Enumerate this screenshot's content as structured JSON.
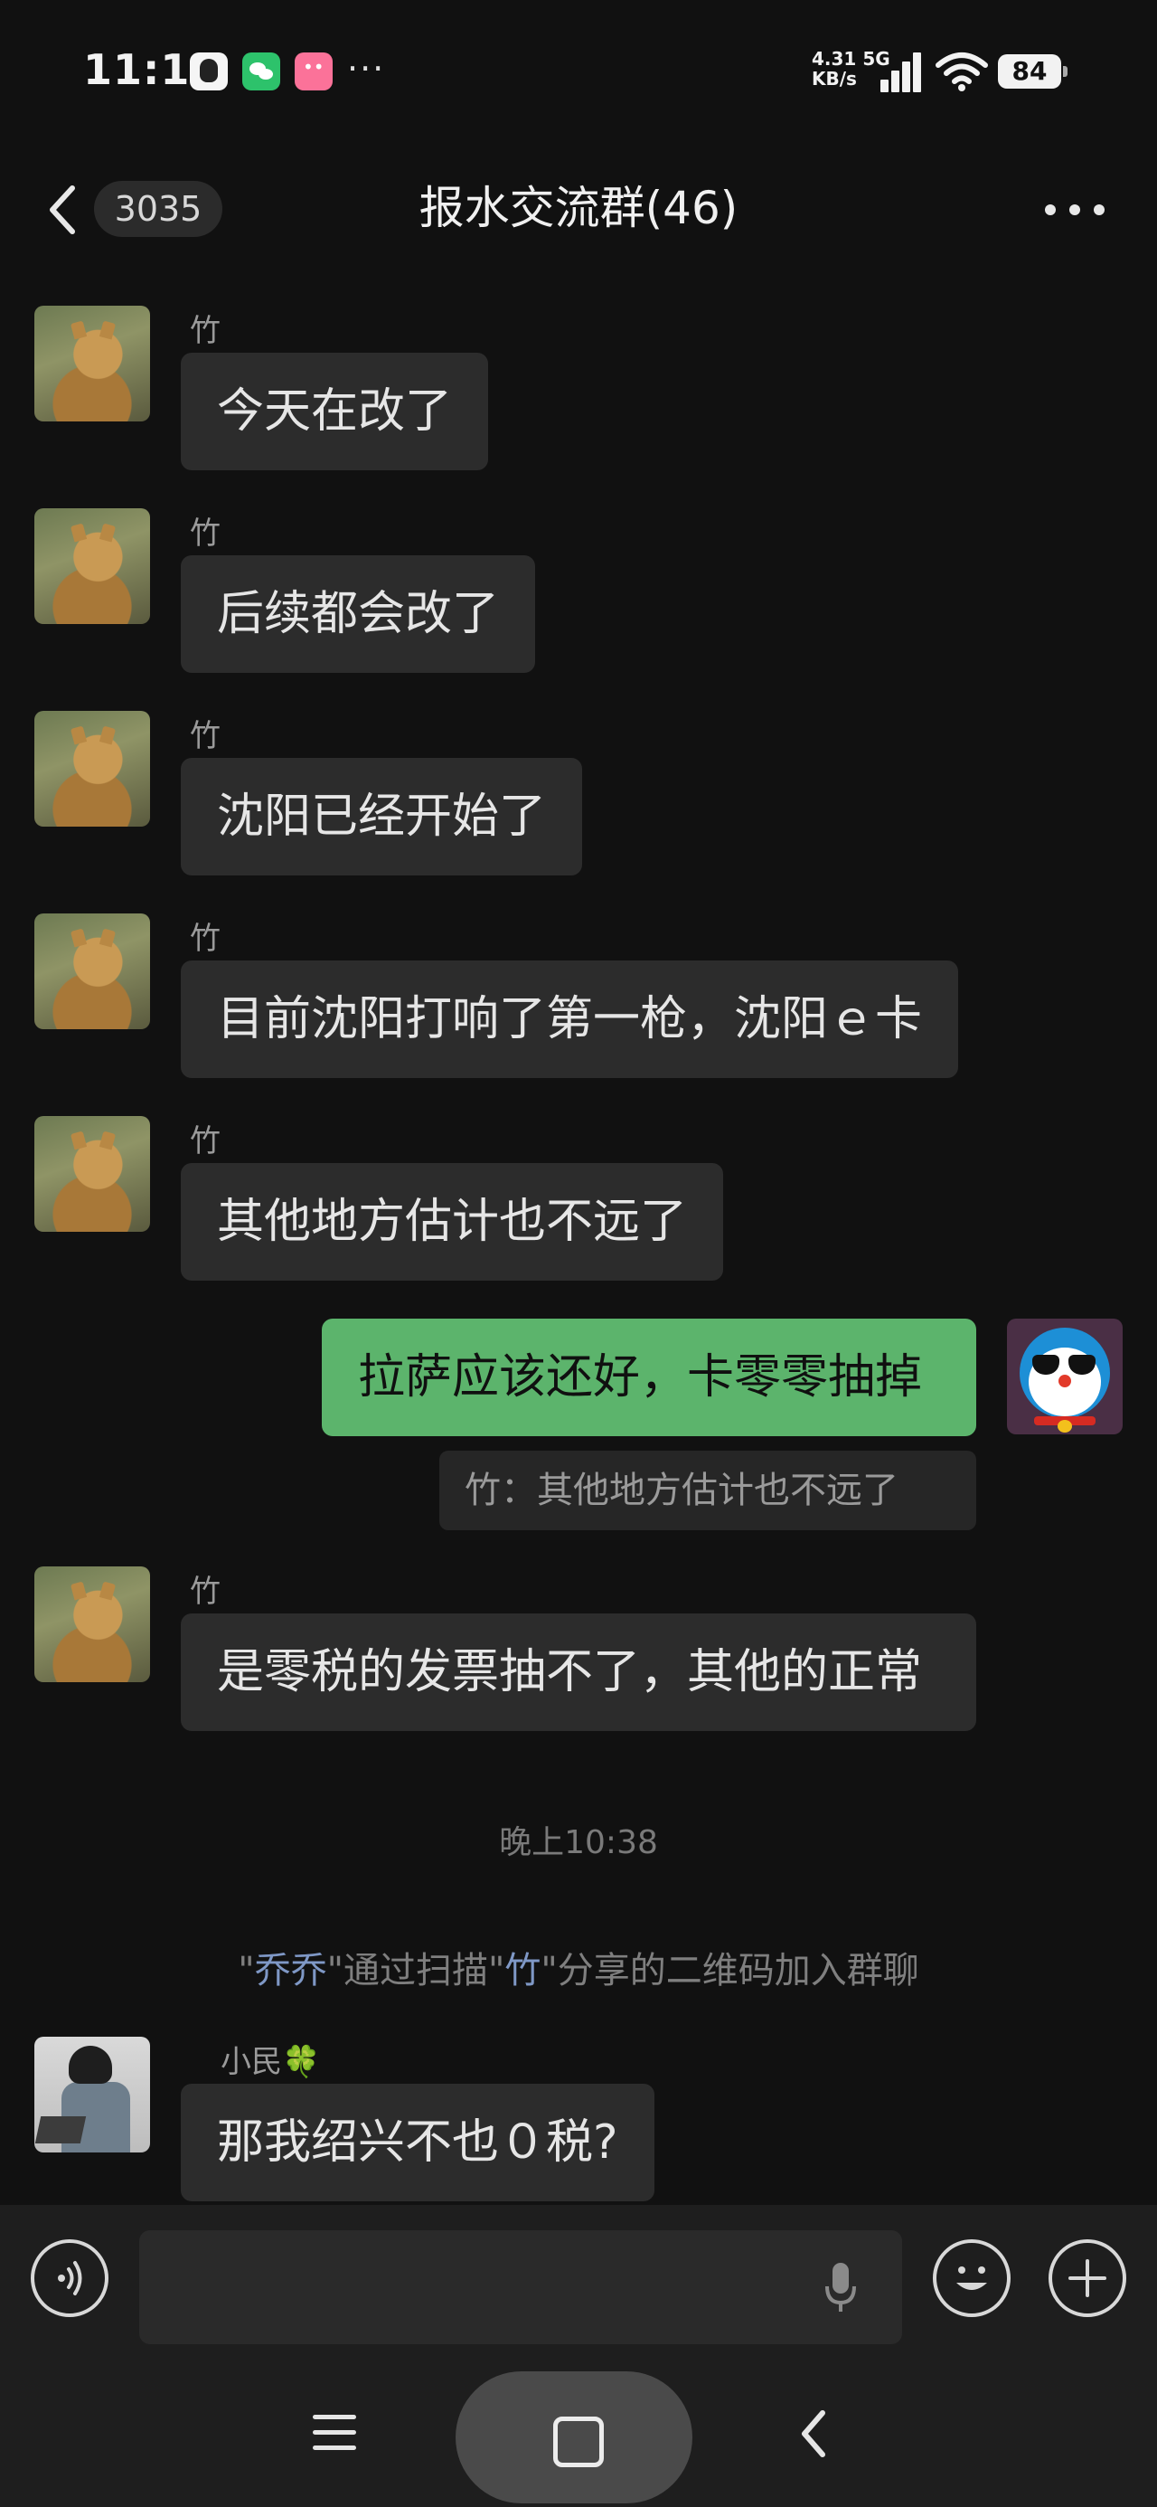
{
  "status_bar": {
    "time": "11:11",
    "network_speed": "4.31",
    "network_unit": "KB/s",
    "network_type": "5G",
    "battery": "84",
    "more_indicator": "···"
  },
  "header": {
    "unread_count": "3035",
    "title": "报水交流群(46)"
  },
  "messages": [
    {
      "sender": "竹",
      "text": "今天在改了"
    },
    {
      "sender": "竹",
      "text": "后续都会改了"
    },
    {
      "sender": "竹",
      "text": "沈阳已经开始了"
    },
    {
      "sender": "竹",
      "text": "目前沈阳打响了第一枪，沈阳ｅ卡"
    },
    {
      "sender": "竹",
      "text": "其他地方估计也不远了"
    },
    {
      "sender": "",
      "text": "拉萨应该还好，卡零零抽掉",
      "quote": "竹：其他地方估计也不远了"
    },
    {
      "sender": "竹",
      "text": "是零税的发票抽不了，其他的正常"
    },
    {
      "sender": "小民🍀",
      "text": "那我绍兴不也０税?"
    }
  ],
  "timestamp": "晚上10:38",
  "system_notice": {
    "q1": "\"",
    "user": "乔乔",
    "mid": "\"通过扫描\"",
    "sharer": "竹",
    "tail": "\"分享的二维码加入群聊"
  },
  "input": {
    "placeholder": ""
  },
  "colors": {
    "background": "#111111",
    "bubble_in": "#2c2c2c",
    "bubble_out": "#5cb46c",
    "system_name": "#7f98c6"
  }
}
